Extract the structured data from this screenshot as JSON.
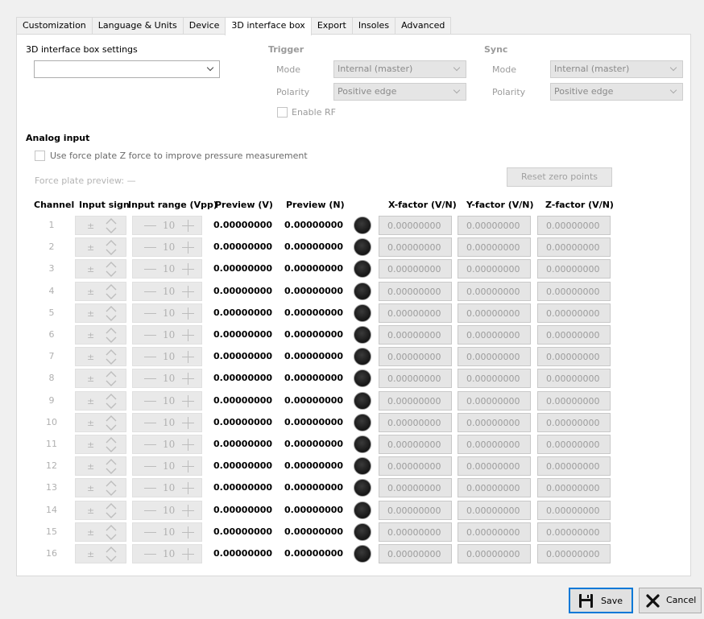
{
  "tabs": [
    {
      "label": "Customization"
    },
    {
      "label": "Language & Units"
    },
    {
      "label": "Device"
    },
    {
      "label": "3D interface box"
    },
    {
      "label": "Export"
    },
    {
      "label": "Insoles"
    },
    {
      "label": "Advanced"
    }
  ],
  "active_tab": "3D interface box",
  "settings": {
    "label": "3D interface box settings",
    "selected": ""
  },
  "trigger": {
    "title": "Trigger",
    "mode_label": "Mode",
    "mode_value": "Internal (master)",
    "polarity_label": "Polarity",
    "polarity_value": "Positive edge",
    "enable_rf_label": "Enable RF"
  },
  "sync": {
    "title": "Sync",
    "mode_label": "Mode",
    "mode_value": "Internal (master)",
    "polarity_label": "Polarity",
    "polarity_value": "Positive edge"
  },
  "analog": {
    "title": "Analog input",
    "use_force_plate_label": "Use force plate Z force to improve pressure measurement",
    "force_plate_preview": "Force plate preview: —",
    "reset_zero_label": "Reset zero points"
  },
  "table": {
    "headers": {
      "channel": "Channel",
      "input_sign": "Input sign",
      "input_range": "Input range (Vpp)",
      "preview_v": "Preview (V)",
      "preview_n": "Preview (N)",
      "x_factor": "X-factor (V/N)",
      "y_factor": "Y-factor (V/N)",
      "z_factor": "Z-factor (V/N)"
    },
    "rows": [
      {
        "channel": "1",
        "sign": "±",
        "range": "10",
        "preview_v": "0.00000000",
        "preview_n": "0.00000000",
        "x": "0.00000000",
        "y": "0.00000000",
        "z": "0.00000000"
      },
      {
        "channel": "2",
        "sign": "±",
        "range": "10",
        "preview_v": "0.00000000",
        "preview_n": "0.00000000",
        "x": "0.00000000",
        "y": "0.00000000",
        "z": "0.00000000"
      },
      {
        "channel": "3",
        "sign": "±",
        "range": "10",
        "preview_v": "0.00000000",
        "preview_n": "0.00000000",
        "x": "0.00000000",
        "y": "0.00000000",
        "z": "0.00000000"
      },
      {
        "channel": "4",
        "sign": "±",
        "range": "10",
        "preview_v": "0.00000000",
        "preview_n": "0.00000000",
        "x": "0.00000000",
        "y": "0.00000000",
        "z": "0.00000000"
      },
      {
        "channel": "5",
        "sign": "±",
        "range": "10",
        "preview_v": "0.00000000",
        "preview_n": "0.00000000",
        "x": "0.00000000",
        "y": "0.00000000",
        "z": "0.00000000"
      },
      {
        "channel": "6",
        "sign": "±",
        "range": "10",
        "preview_v": "0.00000000",
        "preview_n": "0.00000000",
        "x": "0.00000000",
        "y": "0.00000000",
        "z": "0.00000000"
      },
      {
        "channel": "7",
        "sign": "±",
        "range": "10",
        "preview_v": "0.00000000",
        "preview_n": "0.00000000",
        "x": "0.00000000",
        "y": "0.00000000",
        "z": "0.00000000"
      },
      {
        "channel": "8",
        "sign": "±",
        "range": "10",
        "preview_v": "0.00000000",
        "preview_n": "0.00000000",
        "x": "0.00000000",
        "y": "0.00000000",
        "z": "0.00000000"
      },
      {
        "channel": "9",
        "sign": "±",
        "range": "10",
        "preview_v": "0.00000000",
        "preview_n": "0.00000000",
        "x": "0.00000000",
        "y": "0.00000000",
        "z": "0.00000000"
      },
      {
        "channel": "10",
        "sign": "±",
        "range": "10",
        "preview_v": "0.00000000",
        "preview_n": "0.00000000",
        "x": "0.00000000",
        "y": "0.00000000",
        "z": "0.00000000"
      },
      {
        "channel": "11",
        "sign": "±",
        "range": "10",
        "preview_v": "0.00000000",
        "preview_n": "0.00000000",
        "x": "0.00000000",
        "y": "0.00000000",
        "z": "0.00000000"
      },
      {
        "channel": "12",
        "sign": "±",
        "range": "10",
        "preview_v": "0.00000000",
        "preview_n": "0.00000000",
        "x": "0.00000000",
        "y": "0.00000000",
        "z": "0.00000000"
      },
      {
        "channel": "13",
        "sign": "±",
        "range": "10",
        "preview_v": "0.00000000",
        "preview_n": "0.00000000",
        "x": "0.00000000",
        "y": "0.00000000",
        "z": "0.00000000"
      },
      {
        "channel": "14",
        "sign": "±",
        "range": "10",
        "preview_v": "0.00000000",
        "preview_n": "0.00000000",
        "x": "0.00000000",
        "y": "0.00000000",
        "z": "0.00000000"
      },
      {
        "channel": "15",
        "sign": "±",
        "range": "10",
        "preview_v": "0.00000000",
        "preview_n": "0.00000000",
        "x": "0.00000000",
        "y": "0.00000000",
        "z": "0.00000000"
      },
      {
        "channel": "16",
        "sign": "±",
        "range": "10",
        "preview_v": "0.00000000",
        "preview_n": "0.00000000",
        "x": "0.00000000",
        "y": "0.00000000",
        "z": "0.00000000"
      }
    ]
  },
  "footer": {
    "save_label": "Save",
    "cancel_label": "Cancel"
  },
  "icons": {
    "save": "floppy-disk-icon",
    "cancel": "x-icon",
    "led": "status-led-icon"
  },
  "colors": {
    "accent": "#0078d7",
    "disabled_text": "#9b9b9b",
    "led": "#1a1a1a"
  }
}
